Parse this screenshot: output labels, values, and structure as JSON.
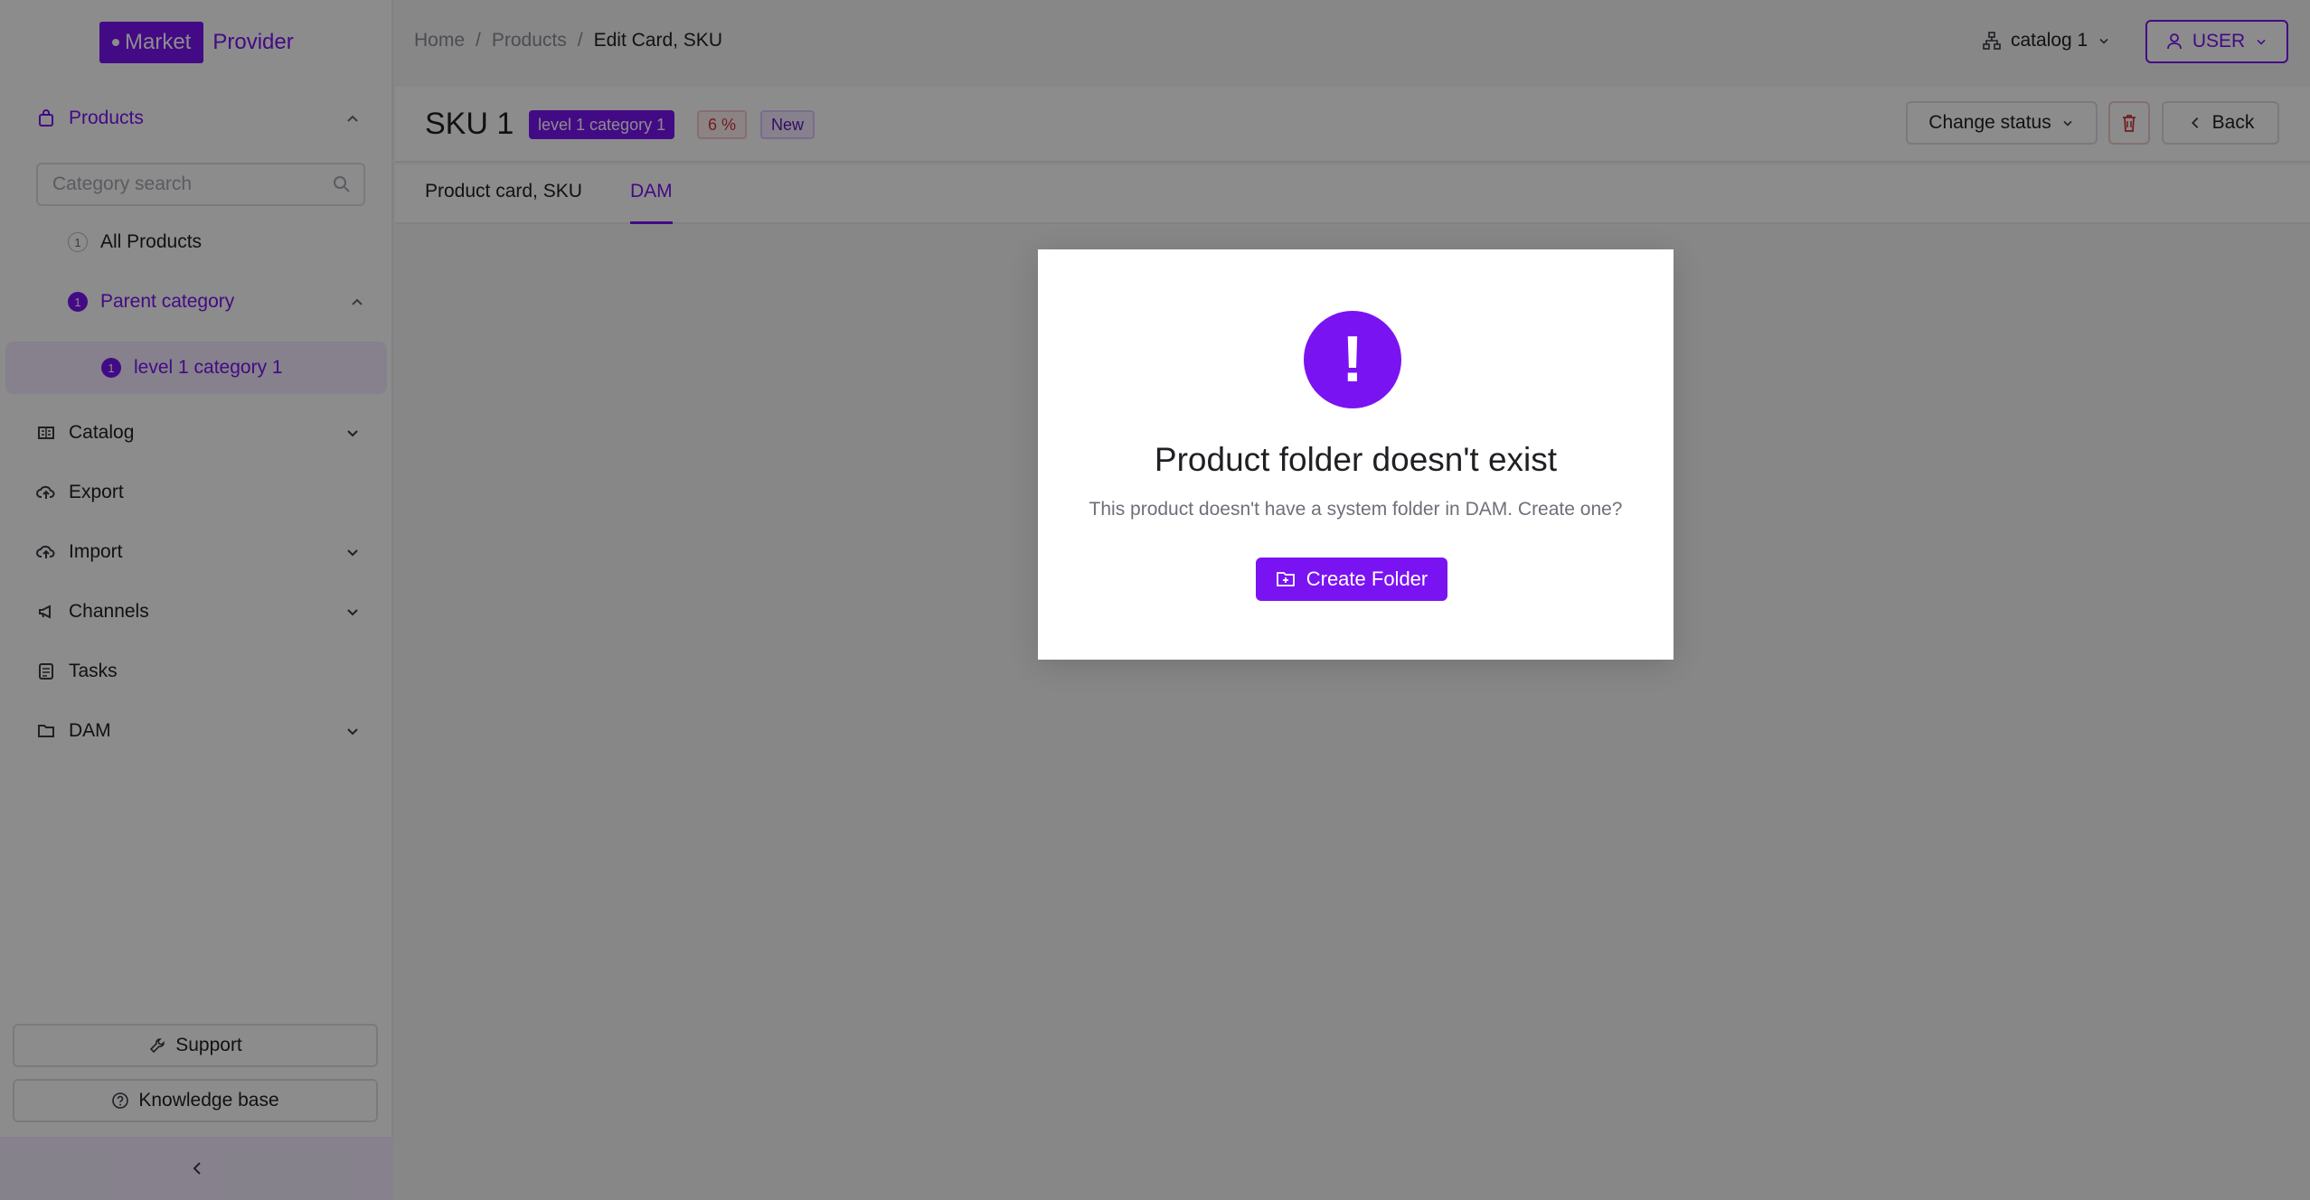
{
  "brand": {
    "logo_left": "Market",
    "logo_right": "Provider"
  },
  "sidebar": {
    "products_label": "Products",
    "category_search_placeholder": "Category search",
    "tree": {
      "all_products": {
        "count": "1",
        "label": "All Products"
      },
      "parent_category": {
        "count": "1",
        "label": "Parent category"
      },
      "child_category": {
        "count": "1",
        "label": "level 1 category 1"
      }
    },
    "items": [
      {
        "label": "Catalog"
      },
      {
        "label": "Export"
      },
      {
        "label": "Import"
      },
      {
        "label": "Channels"
      },
      {
        "label": "Tasks"
      },
      {
        "label": "DAM"
      }
    ],
    "support_label": "Support",
    "knowledge_label": "Knowledge base"
  },
  "header": {
    "breadcrumb": [
      "Home",
      "Products",
      "Edit Card, SKU"
    ],
    "catalog_select": "catalog 1",
    "user_label": "USER"
  },
  "page": {
    "title": "SKU 1",
    "badges": {
      "category": "level 1 category 1",
      "percent": "6 %",
      "status": "New"
    },
    "change_status_label": "Change status",
    "back_label": "Back",
    "tabs": [
      "Product card, SKU",
      "DAM"
    ]
  },
  "modal": {
    "title": "Product folder doesn't exist",
    "subtitle": "This product doesn't have a system folder in DAM. Create one?",
    "button_label": "Create Folder",
    "icon_glyph": "!"
  },
  "colors": {
    "accent": "#7a13f2",
    "danger": "#d0343c"
  }
}
